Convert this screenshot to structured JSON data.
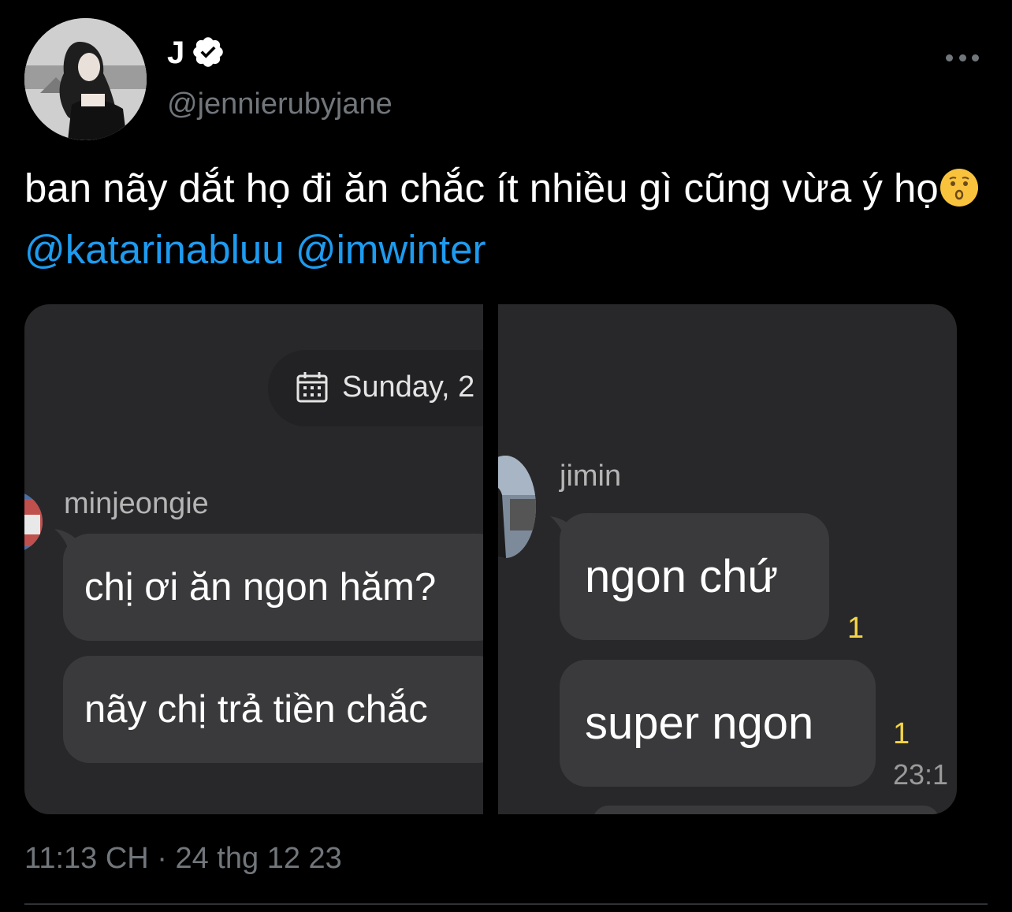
{
  "author": {
    "display_name": "J",
    "handle": "@jennierubyjane"
  },
  "tweet": {
    "text_main": "ban nãy dắt họ đi ăn chắc ít nhiều gì cũng vừa ý họ",
    "emoji": "kissing-face-emoji",
    "mentions": [
      "@katarinabluu",
      "@imwinter"
    ],
    "timestamp": "11:13 CH · 24 thg 12 23"
  },
  "media": {
    "left_panel": {
      "date": "Sunday, 2",
      "sender": "minjeongie",
      "messages": [
        "chị ơi ăn ngon hăm?",
        "nãy chị trả tiền chắc"
      ]
    },
    "right_panel": {
      "sender": "jimin",
      "messages": [
        "ngon chứ",
        "super ngon"
      ],
      "read_counts": [
        "1",
        "1"
      ],
      "time": "23:1"
    }
  },
  "colors": {
    "background": "#000000",
    "mention": "#1d9bf0",
    "secondary_text": "#71767b",
    "verified_badge": "#ffffff",
    "read_count": "#f5d547"
  }
}
